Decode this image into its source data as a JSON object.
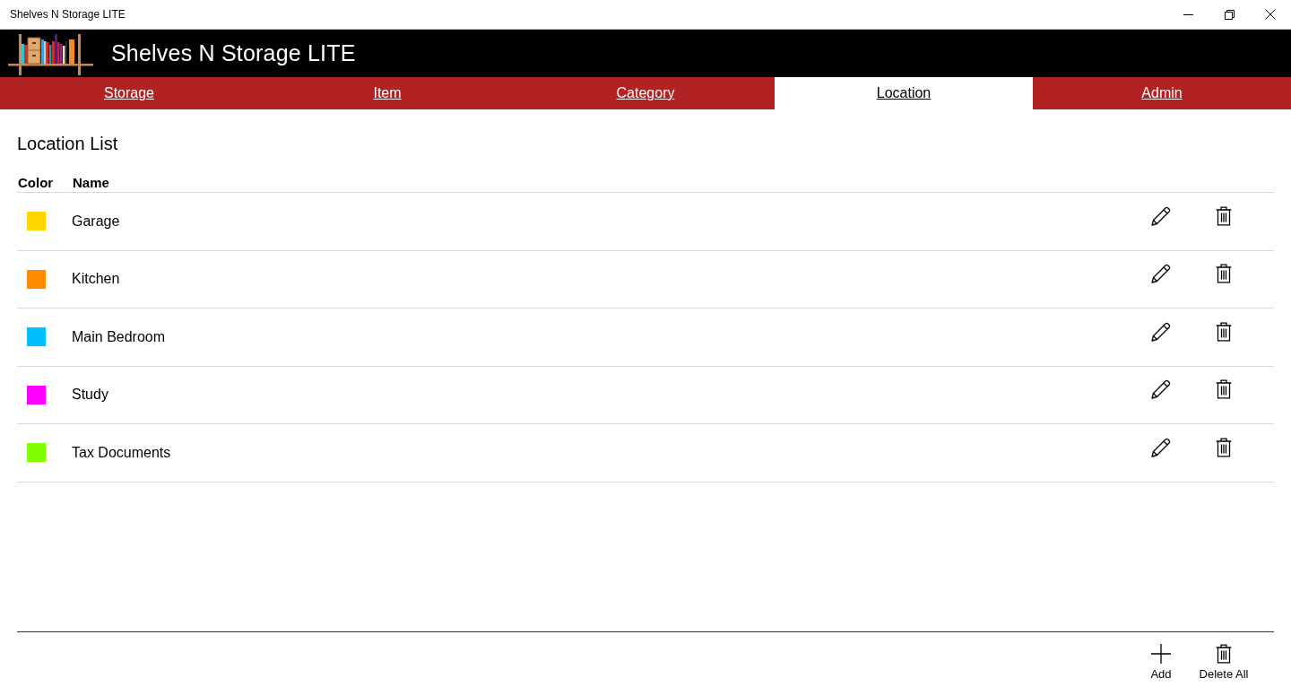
{
  "window": {
    "title": "Shelves N Storage LITE"
  },
  "header": {
    "app_name": "Shelves N Storage LITE"
  },
  "tabs": [
    {
      "label": "Storage",
      "selected": false
    },
    {
      "label": "Item",
      "selected": false
    },
    {
      "label": "Category",
      "selected": false
    },
    {
      "label": "Location",
      "selected": true
    },
    {
      "label": "Admin",
      "selected": false
    }
  ],
  "page_title": "Location List",
  "table": {
    "columns": [
      "Color",
      "Name"
    ],
    "rows": [
      {
        "name": "Garage",
        "color": "#ffd700"
      },
      {
        "name": "Kitchen",
        "color": "#ff8c00"
      },
      {
        "name": "Main Bedroom",
        "color": "#00bfff"
      },
      {
        "name": "Study",
        "color": "#ff00ff"
      },
      {
        "name": "Tax Documents",
        "color": "#7fff00"
      }
    ]
  },
  "toolbar": {
    "buttons": [
      {
        "kind": "add",
        "label": "Add"
      },
      {
        "kind": "delete",
        "label": "Delete All"
      }
    ]
  }
}
